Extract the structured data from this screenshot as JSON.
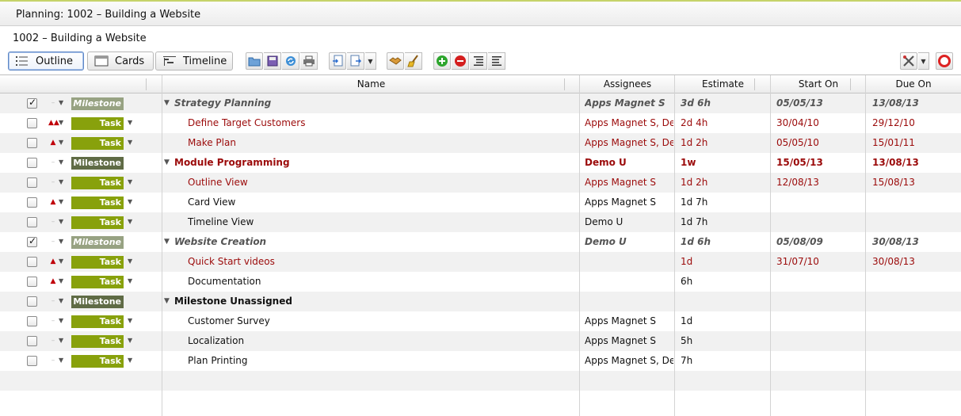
{
  "window_title": "Planning: 1002 – Building a Website",
  "page_title": "1002 – Building a Website",
  "views": {
    "outline": "Outline",
    "cards": "Cards",
    "timeline": "Timeline"
  },
  "columns": {
    "name": "Name",
    "assignees": "Assignees",
    "estimate": "Estimate",
    "start_on": "Start On",
    "due_on": "Due On"
  },
  "colors": {
    "task_badge": "#88a10c",
    "milestone_badge": "#5f6b45",
    "milestone_done_badge": "#97a282",
    "overdue_text": "#9b0a0a"
  },
  "rows": [
    {
      "type": "Milestone",
      "checked": true,
      "priority": "–",
      "name": "Strategy Planning",
      "assignees": "Apps Magnet S",
      "estimate": "3d 6h",
      "start_on": "05/05/13",
      "due_on": "13/08/13"
    },
    {
      "type": "Task",
      "checked": false,
      "priority": "▲▲",
      "name": "Define Target Customers",
      "assignees": "Apps Magnet S, De",
      "estimate": "2d 4h",
      "start_on": "30/04/10",
      "due_on": "29/12/10"
    },
    {
      "type": "Task",
      "checked": false,
      "priority": "▲",
      "name": "Make Plan",
      "assignees": "Apps Magnet S, De",
      "estimate": "1d 2h",
      "start_on": "05/05/10",
      "due_on": "15/01/11"
    },
    {
      "type": "Milestone",
      "checked": false,
      "priority": "–",
      "name": "Module Programming",
      "assignees": "Demo U",
      "estimate": "1w",
      "start_on": "15/05/13",
      "due_on": "13/08/13"
    },
    {
      "type": "Task",
      "checked": false,
      "priority": "–",
      "name": "Outline View",
      "assignees": "Apps Magnet S",
      "estimate": "1d 2h",
      "start_on": "12/08/13",
      "due_on": "15/08/13"
    },
    {
      "type": "Task",
      "checked": false,
      "priority": "▲",
      "name": "Card View",
      "assignees": "Apps Magnet S",
      "estimate": "1d 7h",
      "start_on": "",
      "due_on": ""
    },
    {
      "type": "Task",
      "checked": false,
      "priority": "–",
      "name": "Timeline View",
      "assignees": "Demo U",
      "estimate": "1d 7h",
      "start_on": "",
      "due_on": ""
    },
    {
      "type": "Milestone",
      "checked": true,
      "priority": "–",
      "name": "Website Creation",
      "assignees": "Demo U",
      "estimate": "1d 6h",
      "start_on": "05/08/09",
      "due_on": "30/08/13"
    },
    {
      "type": "Task",
      "checked": false,
      "priority": "▲",
      "name": "Quick Start videos",
      "assignees": "",
      "estimate": "1d",
      "start_on": "31/07/10",
      "due_on": "30/08/13"
    },
    {
      "type": "Task",
      "checked": false,
      "priority": "▲",
      "name": "Documentation",
      "assignees": "",
      "estimate": "6h",
      "start_on": "",
      "due_on": ""
    },
    {
      "type": "Milestone",
      "checked": false,
      "priority": "–",
      "name": "Milestone Unassigned",
      "assignees": "",
      "estimate": "",
      "start_on": "",
      "due_on": ""
    },
    {
      "type": "Task",
      "checked": false,
      "priority": "–",
      "name": "Customer Survey",
      "assignees": "Apps Magnet S",
      "estimate": "1d",
      "start_on": "",
      "due_on": ""
    },
    {
      "type": "Task",
      "checked": false,
      "priority": "–",
      "name": "Localization",
      "assignees": "Apps Magnet S",
      "estimate": "5h",
      "start_on": "",
      "due_on": ""
    },
    {
      "type": "Task",
      "checked": false,
      "priority": "–",
      "name": "Plan Printing",
      "assignees": "Apps Magnet S, De",
      "estimate": "7h",
      "start_on": "",
      "due_on": ""
    }
  ]
}
